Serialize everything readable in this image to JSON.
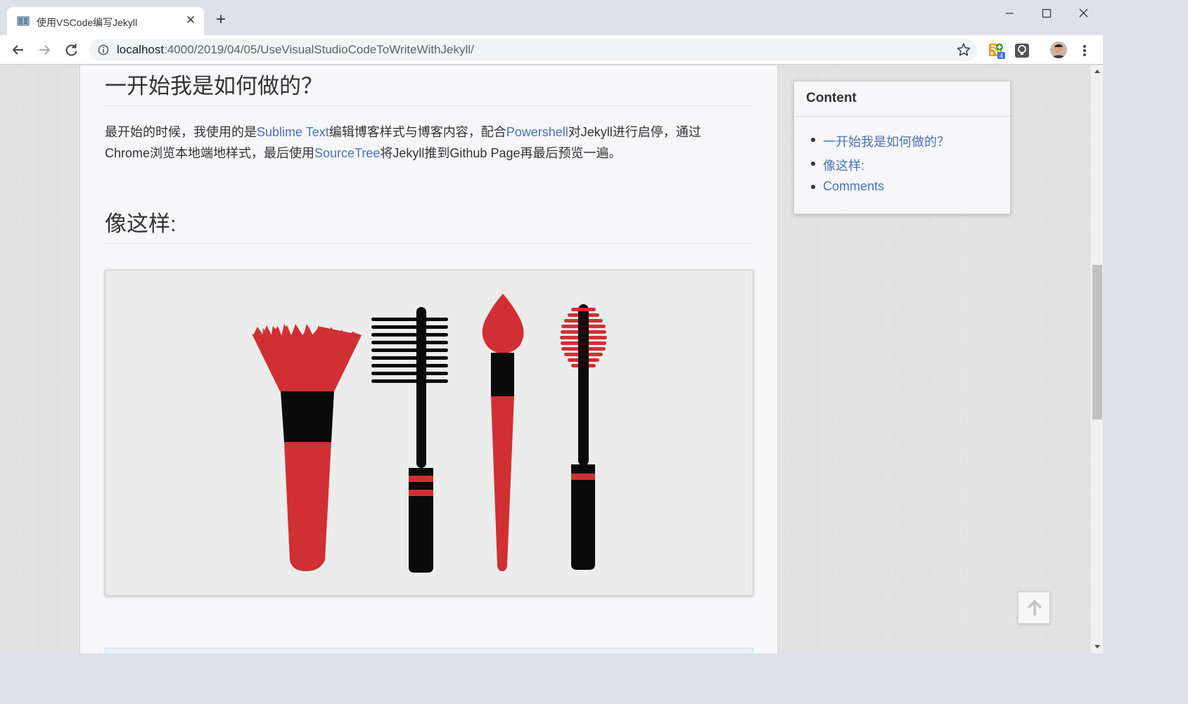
{
  "browser": {
    "tab": {
      "title": "使用VSCode编写Jekyll",
      "close_glyph": "✕"
    },
    "new_tab_glyph": "+",
    "url": {
      "host": "localhost",
      "path": ":4000/2019/04/05/UseVisualStudioCodeToWriteWithJekyll/"
    },
    "extension_badge": "4"
  },
  "article": {
    "heading_1": "一开始我是如何做的？",
    "paragraph": {
      "t1": "最开始的时候，我使用的是",
      "link1": "Sublime Text",
      "t2": "编辑博客样式与博客内容，配合",
      "link2": "Powershell",
      "t3": "对Jekyll进行启停，通过Chrome浏览本地端地样式，最后使用",
      "link3": "SourceTree",
      "t4": "将Jekyll推到Github Page再最后预览一遍。"
    },
    "heading_2": "像这样:"
  },
  "toc": {
    "title": "Content",
    "items": [
      {
        "label": "一开始我是如何做的？"
      },
      {
        "label": "像这样:"
      },
      {
        "label": "Comments"
      }
    ]
  },
  "colors": {
    "link": "#4a72b5",
    "accent_red": "#d03033",
    "ink": "#0a0a0a"
  }
}
